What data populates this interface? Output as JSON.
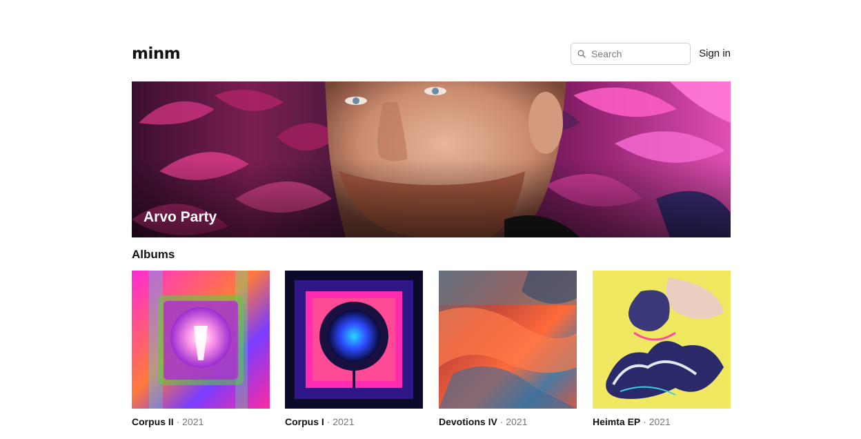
{
  "header": {
    "logo": "minm",
    "search_placeholder": "Search",
    "signin_label": "Sign in"
  },
  "hero": {
    "artist_name": "Arvo Party"
  },
  "albums_section": {
    "title": "Albums",
    "separator": "·",
    "items": [
      {
        "name": "Corpus II",
        "year": "2021"
      },
      {
        "name": "Corpus I",
        "year": "2021"
      },
      {
        "name": "Devotions IV",
        "year": "2021"
      },
      {
        "name": "Heimta EP",
        "year": "2021"
      }
    ]
  }
}
